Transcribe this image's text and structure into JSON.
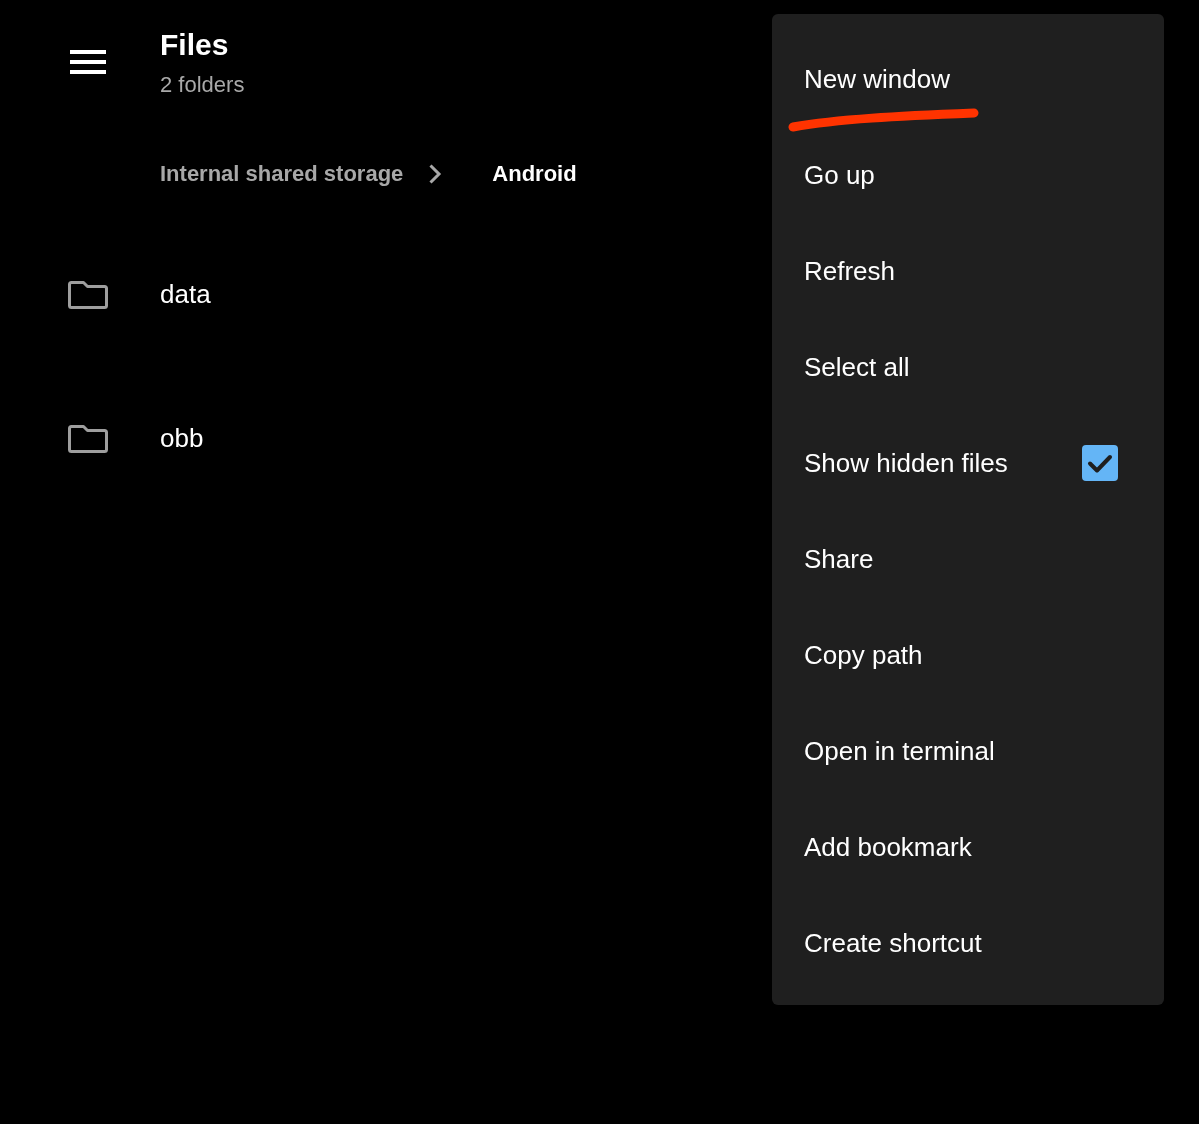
{
  "toolbar": {
    "title": "Files",
    "subtitle": "2 folders"
  },
  "breadcrumbs": [
    {
      "label": "Internal shared storage",
      "current": false
    },
    {
      "label": "Android",
      "current": true
    }
  ],
  "folders": [
    {
      "name": "data"
    },
    {
      "name": "obb"
    }
  ],
  "menu": {
    "items": [
      {
        "kind": "action",
        "label": "New window",
        "underlined": true
      },
      {
        "kind": "action",
        "label": "Go up",
        "underlined": false
      },
      {
        "kind": "action",
        "label": "Refresh",
        "underlined": false
      },
      {
        "kind": "action",
        "label": "Select all",
        "underlined": false
      },
      {
        "kind": "checkbox",
        "label": "Show hidden files",
        "checked": true,
        "underlined": false
      },
      {
        "kind": "action",
        "label": "Share",
        "underlined": false
      },
      {
        "kind": "action",
        "label": "Copy path",
        "underlined": false
      },
      {
        "kind": "action",
        "label": "Open in terminal",
        "underlined": false
      },
      {
        "kind": "action",
        "label": "Add bookmark",
        "underlined": false
      },
      {
        "kind": "action",
        "label": "Create shortcut",
        "underlined": false
      }
    ]
  }
}
